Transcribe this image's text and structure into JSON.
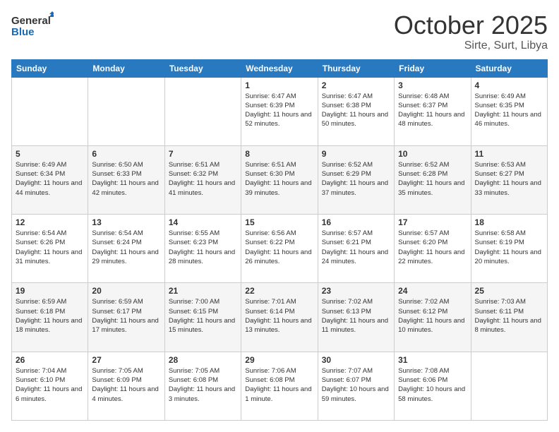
{
  "header": {
    "logo_general": "General",
    "logo_blue": "Blue",
    "month_title": "October 2025",
    "location": "Sirte, Surt, Libya"
  },
  "calendar": {
    "days_of_week": [
      "Sunday",
      "Monday",
      "Tuesday",
      "Wednesday",
      "Thursday",
      "Friday",
      "Saturday"
    ],
    "weeks": [
      [
        {
          "day": "",
          "info": ""
        },
        {
          "day": "",
          "info": ""
        },
        {
          "day": "",
          "info": ""
        },
        {
          "day": "1",
          "info": "Sunrise: 6:47 AM\nSunset: 6:39 PM\nDaylight: 11 hours\nand 52 minutes."
        },
        {
          "day": "2",
          "info": "Sunrise: 6:47 AM\nSunset: 6:38 PM\nDaylight: 11 hours\nand 50 minutes."
        },
        {
          "day": "3",
          "info": "Sunrise: 6:48 AM\nSunset: 6:37 PM\nDaylight: 11 hours\nand 48 minutes."
        },
        {
          "day": "4",
          "info": "Sunrise: 6:49 AM\nSunset: 6:35 PM\nDaylight: 11 hours\nand 46 minutes."
        }
      ],
      [
        {
          "day": "5",
          "info": "Sunrise: 6:49 AM\nSunset: 6:34 PM\nDaylight: 11 hours\nand 44 minutes."
        },
        {
          "day": "6",
          "info": "Sunrise: 6:50 AM\nSunset: 6:33 PM\nDaylight: 11 hours\nand 42 minutes."
        },
        {
          "day": "7",
          "info": "Sunrise: 6:51 AM\nSunset: 6:32 PM\nDaylight: 11 hours\nand 41 minutes."
        },
        {
          "day": "8",
          "info": "Sunrise: 6:51 AM\nSunset: 6:30 PM\nDaylight: 11 hours\nand 39 minutes."
        },
        {
          "day": "9",
          "info": "Sunrise: 6:52 AM\nSunset: 6:29 PM\nDaylight: 11 hours\nand 37 minutes."
        },
        {
          "day": "10",
          "info": "Sunrise: 6:52 AM\nSunset: 6:28 PM\nDaylight: 11 hours\nand 35 minutes."
        },
        {
          "day": "11",
          "info": "Sunrise: 6:53 AM\nSunset: 6:27 PM\nDaylight: 11 hours\nand 33 minutes."
        }
      ],
      [
        {
          "day": "12",
          "info": "Sunrise: 6:54 AM\nSunset: 6:26 PM\nDaylight: 11 hours\nand 31 minutes."
        },
        {
          "day": "13",
          "info": "Sunrise: 6:54 AM\nSunset: 6:24 PM\nDaylight: 11 hours\nand 29 minutes."
        },
        {
          "day": "14",
          "info": "Sunrise: 6:55 AM\nSunset: 6:23 PM\nDaylight: 11 hours\nand 28 minutes."
        },
        {
          "day": "15",
          "info": "Sunrise: 6:56 AM\nSunset: 6:22 PM\nDaylight: 11 hours\nand 26 minutes."
        },
        {
          "day": "16",
          "info": "Sunrise: 6:57 AM\nSunset: 6:21 PM\nDaylight: 11 hours\nand 24 minutes."
        },
        {
          "day": "17",
          "info": "Sunrise: 6:57 AM\nSunset: 6:20 PM\nDaylight: 11 hours\nand 22 minutes."
        },
        {
          "day": "18",
          "info": "Sunrise: 6:58 AM\nSunset: 6:19 PM\nDaylight: 11 hours\nand 20 minutes."
        }
      ],
      [
        {
          "day": "19",
          "info": "Sunrise: 6:59 AM\nSunset: 6:18 PM\nDaylight: 11 hours\nand 18 minutes."
        },
        {
          "day": "20",
          "info": "Sunrise: 6:59 AM\nSunset: 6:17 PM\nDaylight: 11 hours\nand 17 minutes."
        },
        {
          "day": "21",
          "info": "Sunrise: 7:00 AM\nSunset: 6:15 PM\nDaylight: 11 hours\nand 15 minutes."
        },
        {
          "day": "22",
          "info": "Sunrise: 7:01 AM\nSunset: 6:14 PM\nDaylight: 11 hours\nand 13 minutes."
        },
        {
          "day": "23",
          "info": "Sunrise: 7:02 AM\nSunset: 6:13 PM\nDaylight: 11 hours\nand 11 minutes."
        },
        {
          "day": "24",
          "info": "Sunrise: 7:02 AM\nSunset: 6:12 PM\nDaylight: 11 hours\nand 10 minutes."
        },
        {
          "day": "25",
          "info": "Sunrise: 7:03 AM\nSunset: 6:11 PM\nDaylight: 11 hours\nand 8 minutes."
        }
      ],
      [
        {
          "day": "26",
          "info": "Sunrise: 7:04 AM\nSunset: 6:10 PM\nDaylight: 11 hours\nand 6 minutes."
        },
        {
          "day": "27",
          "info": "Sunrise: 7:05 AM\nSunset: 6:09 PM\nDaylight: 11 hours\nand 4 minutes."
        },
        {
          "day": "28",
          "info": "Sunrise: 7:05 AM\nSunset: 6:08 PM\nDaylight: 11 hours\nand 3 minutes."
        },
        {
          "day": "29",
          "info": "Sunrise: 7:06 AM\nSunset: 6:08 PM\nDaylight: 11 hours\nand 1 minute."
        },
        {
          "day": "30",
          "info": "Sunrise: 7:07 AM\nSunset: 6:07 PM\nDaylight: 10 hours\nand 59 minutes."
        },
        {
          "day": "31",
          "info": "Sunrise: 7:08 AM\nSunset: 6:06 PM\nDaylight: 10 hours\nand 58 minutes."
        },
        {
          "day": "",
          "info": ""
        }
      ]
    ]
  }
}
